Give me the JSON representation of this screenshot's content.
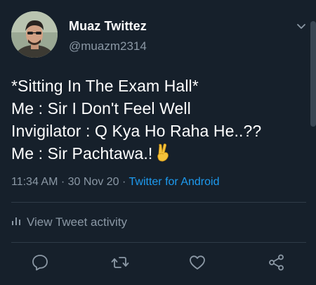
{
  "tweet": {
    "author_name": "Muaz Twittez",
    "author_handle": "@muazm2314",
    "lines": [
      "*Sitting In The Exam Hall*",
      "Me : Sir I Don't Feel Well",
      "Invigilator : Q Kya Ho Raha He..??",
      "Me : Sir Pachtawa.!"
    ],
    "emoji": "victory-hand-emoji",
    "time": "11:34 AM",
    "date": "30 Nov 20",
    "separator": " · ",
    "source": "Twitter for Android",
    "activity_label": "View Tweet activity"
  },
  "icons": {
    "caret": "chevron-down-icon",
    "activity": "bar-chart-icon",
    "reply": "reply-icon",
    "retweet": "retweet-icon",
    "like": "heart-icon",
    "share": "share-icon"
  },
  "colors": {
    "background": "#16202b",
    "text": "#ffffff",
    "secondary": "#8b98a5",
    "link": "#1d9bf0",
    "divider": "#2f3b47"
  }
}
